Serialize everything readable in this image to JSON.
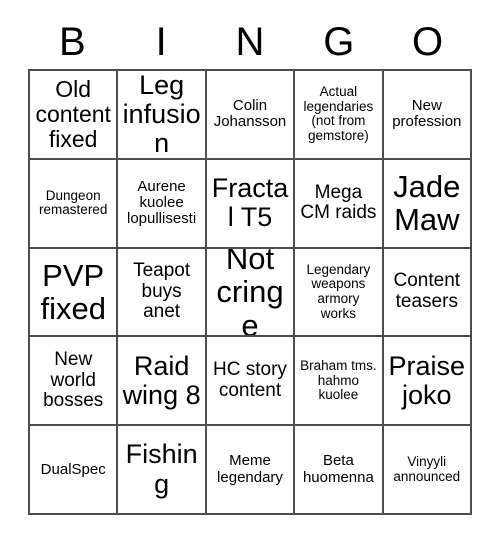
{
  "card": {
    "header_letters": [
      "B",
      "I",
      "N",
      "G",
      "O"
    ],
    "columns": 5,
    "rows": 5,
    "colors": {
      "background": "#ffffff",
      "text": "#000000",
      "grid_line": "#4d4d4d"
    },
    "cells": [
      {
        "text": "Old content fixed",
        "size": "fs-lg"
      },
      {
        "text": "Leg infusion",
        "size": "fs-xl"
      },
      {
        "text": "Colin Johansson",
        "size": "fs-sm"
      },
      {
        "text": "Actual legendaries (not from gemstore)",
        "size": "fs-xs"
      },
      {
        "text": "New profession",
        "size": "fs-sm"
      },
      {
        "text": "Dungeon remastered",
        "size": "fs-xs"
      },
      {
        "text": "Aurene kuolee lopullisesti",
        "size": "fs-sm"
      },
      {
        "text": "Fractal T5",
        "size": "fs-xl"
      },
      {
        "text": "Mega CM raids",
        "size": "fs-md"
      },
      {
        "text": "Jade Maw",
        "size": "fs-xxl"
      },
      {
        "text": "PVP fixed",
        "size": "fs-xxl"
      },
      {
        "text": "Teapot buys anet",
        "size": "fs-md"
      },
      {
        "text": "Not cringe",
        "size": "fs-xxl"
      },
      {
        "text": "Legendary weapons armory works",
        "size": "fs-xs"
      },
      {
        "text": "Content teasers",
        "size": "fs-md"
      },
      {
        "text": "New world bosses",
        "size": "fs-md"
      },
      {
        "text": "Raid wing 8",
        "size": "fs-xl"
      },
      {
        "text": "HC story content",
        "size": "fs-md"
      },
      {
        "text": "Braham tms. hahmo kuolee",
        "size": "fs-xs"
      },
      {
        "text": "Praise joko",
        "size": "fs-xl"
      },
      {
        "text": "DualSpec",
        "size": "fs-sm"
      },
      {
        "text": "Fishing",
        "size": "fs-xl"
      },
      {
        "text": "Meme legendary",
        "size": "fs-sm"
      },
      {
        "text": "Beta huomenna",
        "size": "fs-sm"
      },
      {
        "text": "Vinyyli announced",
        "size": "fs-xs"
      }
    ]
  }
}
